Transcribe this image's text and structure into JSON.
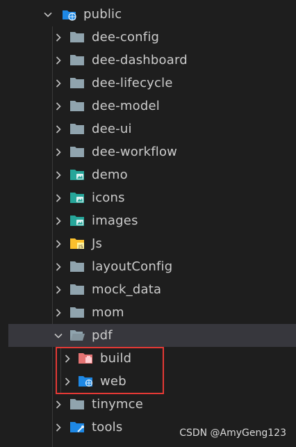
{
  "colors": {
    "folder_gray": "#90a4ae",
    "folder_blue": "#1e88e5",
    "folder_teal": "#26a69a",
    "folder_yellow": "#fbc02d",
    "folder_red": "#e57373",
    "highlight_border": "#e53935",
    "selected_row_bg": "#37373d"
  },
  "tree": {
    "root": {
      "label": "public",
      "icon": "folder-public-open-icon",
      "expanded": true
    },
    "items": [
      {
        "label": "dee-config",
        "icon": "folder-icon",
        "expanded": false
      },
      {
        "label": "dee-dashboard",
        "icon": "folder-icon",
        "expanded": false
      },
      {
        "label": "dee-lifecycle",
        "icon": "folder-icon",
        "expanded": false
      },
      {
        "label": "dee-model",
        "icon": "folder-icon",
        "expanded": false
      },
      {
        "label": "dee-ui",
        "icon": "folder-icon",
        "expanded": false
      },
      {
        "label": "dee-workflow",
        "icon": "folder-icon",
        "expanded": false
      },
      {
        "label": "demo",
        "icon": "folder-images-icon",
        "expanded": false
      },
      {
        "label": "icons",
        "icon": "folder-images-icon",
        "expanded": false
      },
      {
        "label": "images",
        "icon": "folder-images-icon",
        "expanded": false
      },
      {
        "label": "Js",
        "icon": "folder-javascript-icon",
        "expanded": false
      },
      {
        "label": "layoutConfig",
        "icon": "folder-icon",
        "expanded": false
      },
      {
        "label": "mock_data",
        "icon": "folder-icon",
        "expanded": false
      },
      {
        "label": "mom",
        "icon": "folder-icon",
        "expanded": false
      },
      {
        "label": "pdf",
        "icon": "folder-open-icon",
        "expanded": true,
        "selected": true
      },
      {
        "label": "build",
        "icon": "folder-build-icon",
        "expanded": false
      },
      {
        "label": "web",
        "icon": "folder-web-icon",
        "expanded": false
      },
      {
        "label": "tinymce",
        "icon": "folder-icon",
        "expanded": false
      },
      {
        "label": "tools",
        "icon": "folder-tools-icon",
        "expanded": false
      }
    ]
  },
  "watermark": "CSDN @AmyGeng123"
}
